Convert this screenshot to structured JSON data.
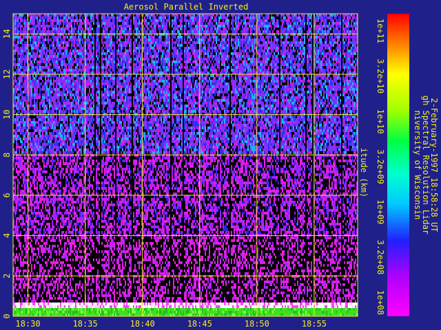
{
  "chart_data": {
    "type": "heatmap",
    "title": "Aerosol Parallel Inverted",
    "ylabel": "itude (km)",
    "x_ticks": [
      "18:30",
      "18:35",
      "18:40",
      "18:45",
      "18:50",
      "18:55"
    ],
    "x_tick_minutes": [
      30,
      35,
      40,
      45,
      50,
      55
    ],
    "x_range_minutes": [
      28.7,
      58.8
    ],
    "y_ticks": [
      "0",
      "2",
      "4",
      "6",
      "8",
      "10",
      "12",
      "14"
    ],
    "y_tick_values": [
      0,
      2,
      4,
      6,
      8,
      10,
      12,
      14
    ],
    "ylim": [
      0,
      15
    ],
    "grid": true,
    "colorbar": {
      "scale": "log",
      "labels": [
        "1e+08",
        "3.2e+08",
        "1e+09",
        "3.2e+09",
        "1e+10",
        "3.2e+10",
        "1e+11"
      ]
    },
    "info_lines": [
      "niversity of Wisconsin",
      "gh Spectral Resolution Lidar",
      "2-February-1997 18:58:28 UT"
    ]
  },
  "colors": {
    "background": "#20208a",
    "text": "#f0f020",
    "grid": "#f0f020"
  }
}
